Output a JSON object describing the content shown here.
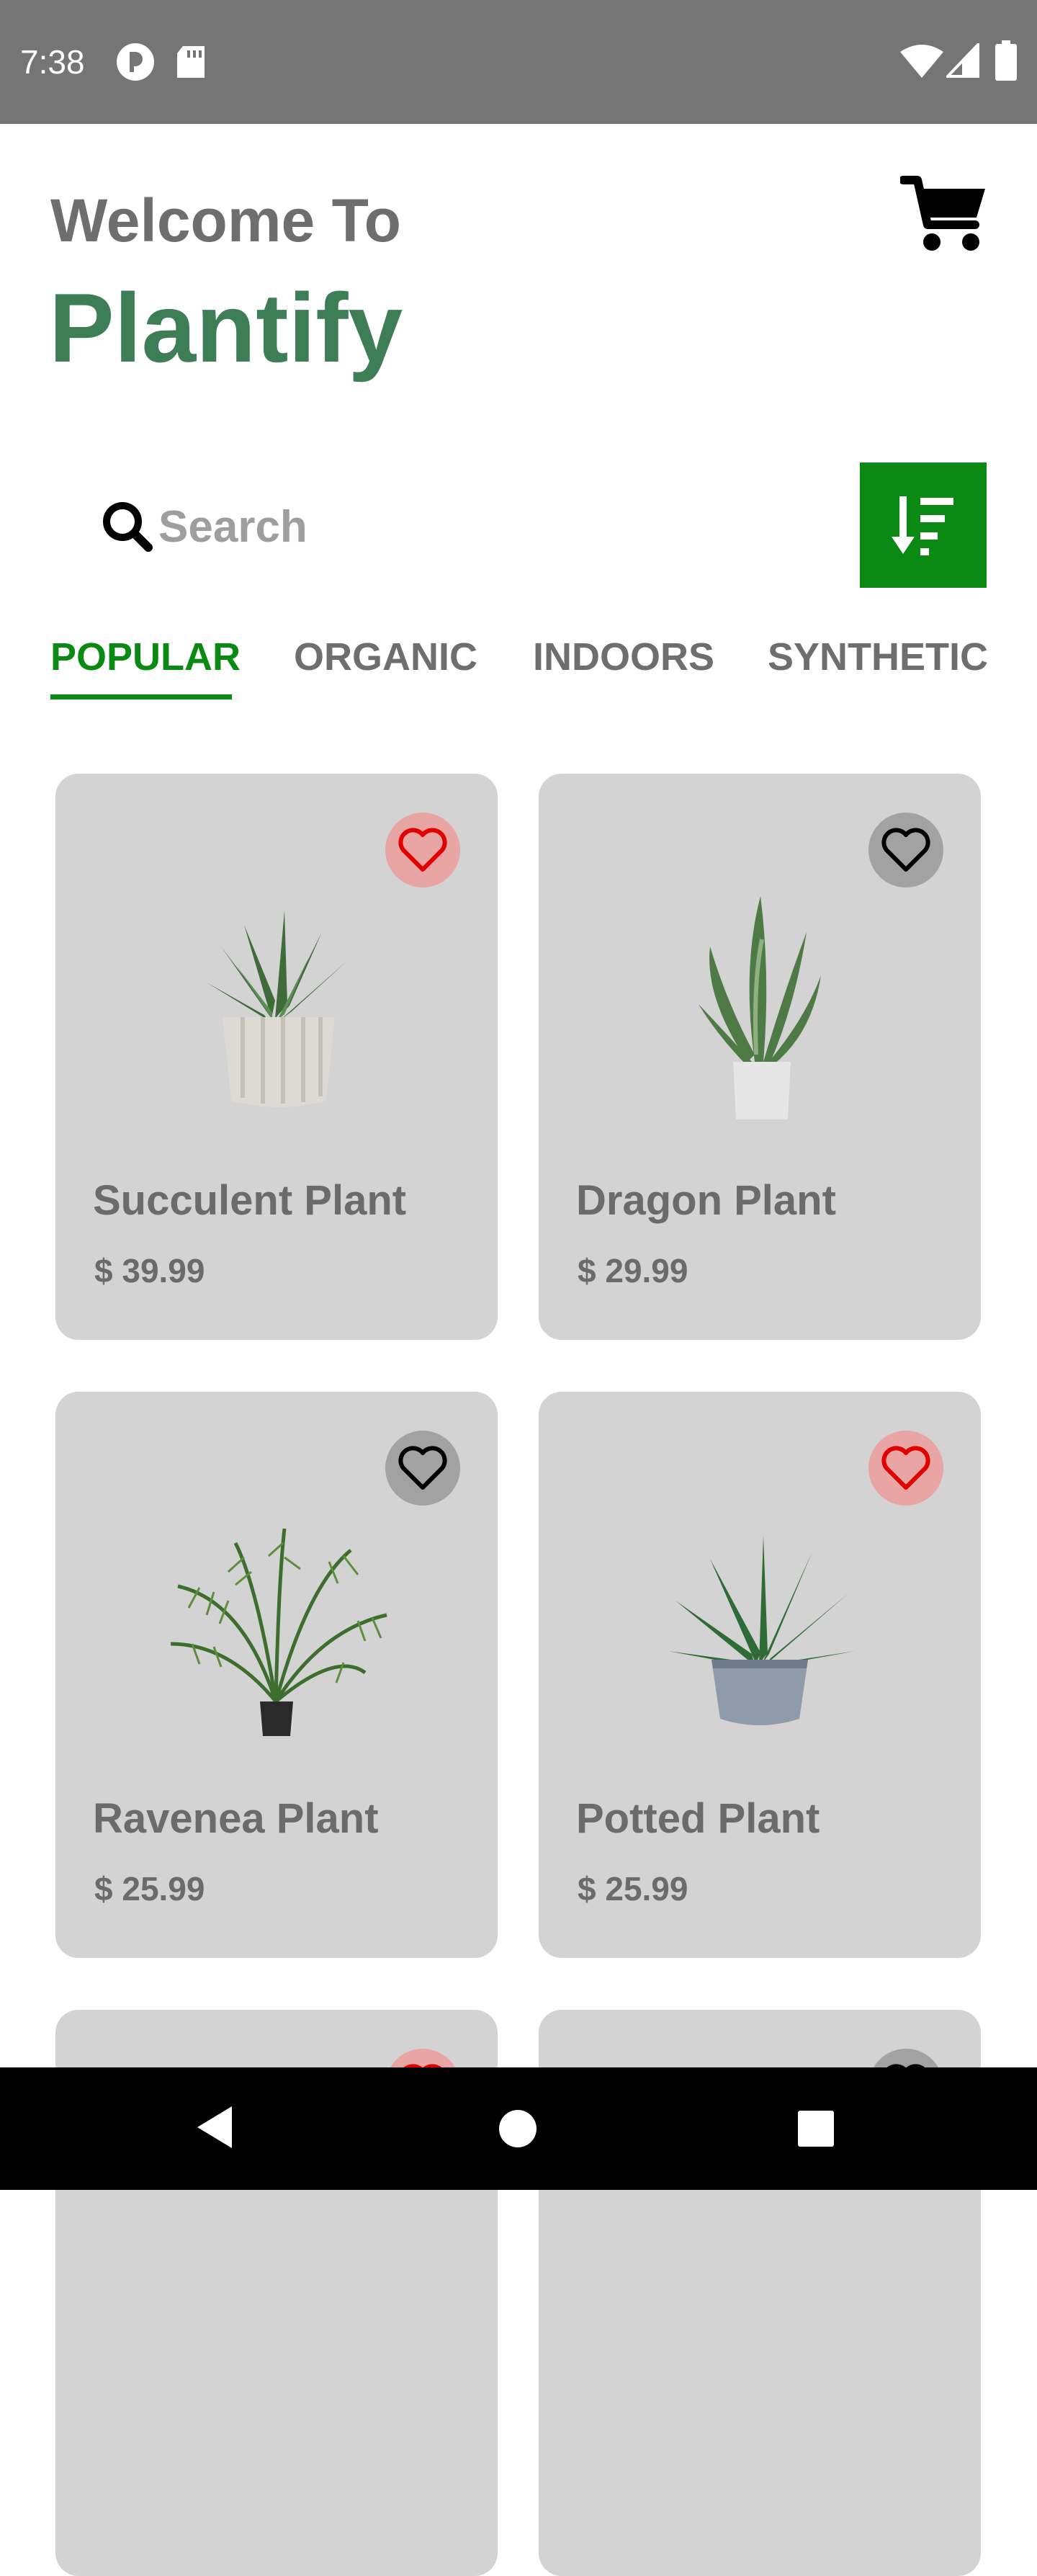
{
  "status_bar": {
    "time": "7:38"
  },
  "header": {
    "welcome": "Welcome To",
    "brand": "Plantify"
  },
  "search": {
    "placeholder": "Search"
  },
  "tabs": [
    {
      "label": "POPULAR",
      "active": true
    },
    {
      "label": "ORGANIC",
      "active": false
    },
    {
      "label": "INDOORS",
      "active": false
    },
    {
      "label": "SYNTHETIC",
      "active": false
    }
  ],
  "products": [
    {
      "name": "Succulent Plant",
      "price": "$ 39.99",
      "favorite": true
    },
    {
      "name": "Dragon Plant",
      "price": "$ 29.99",
      "favorite": false
    },
    {
      "name": "Ravenea Plant",
      "price": "$ 25.99",
      "favorite": false
    },
    {
      "name": "Potted Plant",
      "price": "$ 25.99",
      "favorite": true
    }
  ],
  "colors": {
    "brand_green": "#3e7e56",
    "accent_green": "#0b8a13",
    "card_bg": "#d3d3d3",
    "favorite_red": "#e00000"
  },
  "icons": [
    "cart-icon",
    "search-icon",
    "sort-icon",
    "heart-icon",
    "back-icon",
    "home-icon",
    "recents-icon"
  ]
}
